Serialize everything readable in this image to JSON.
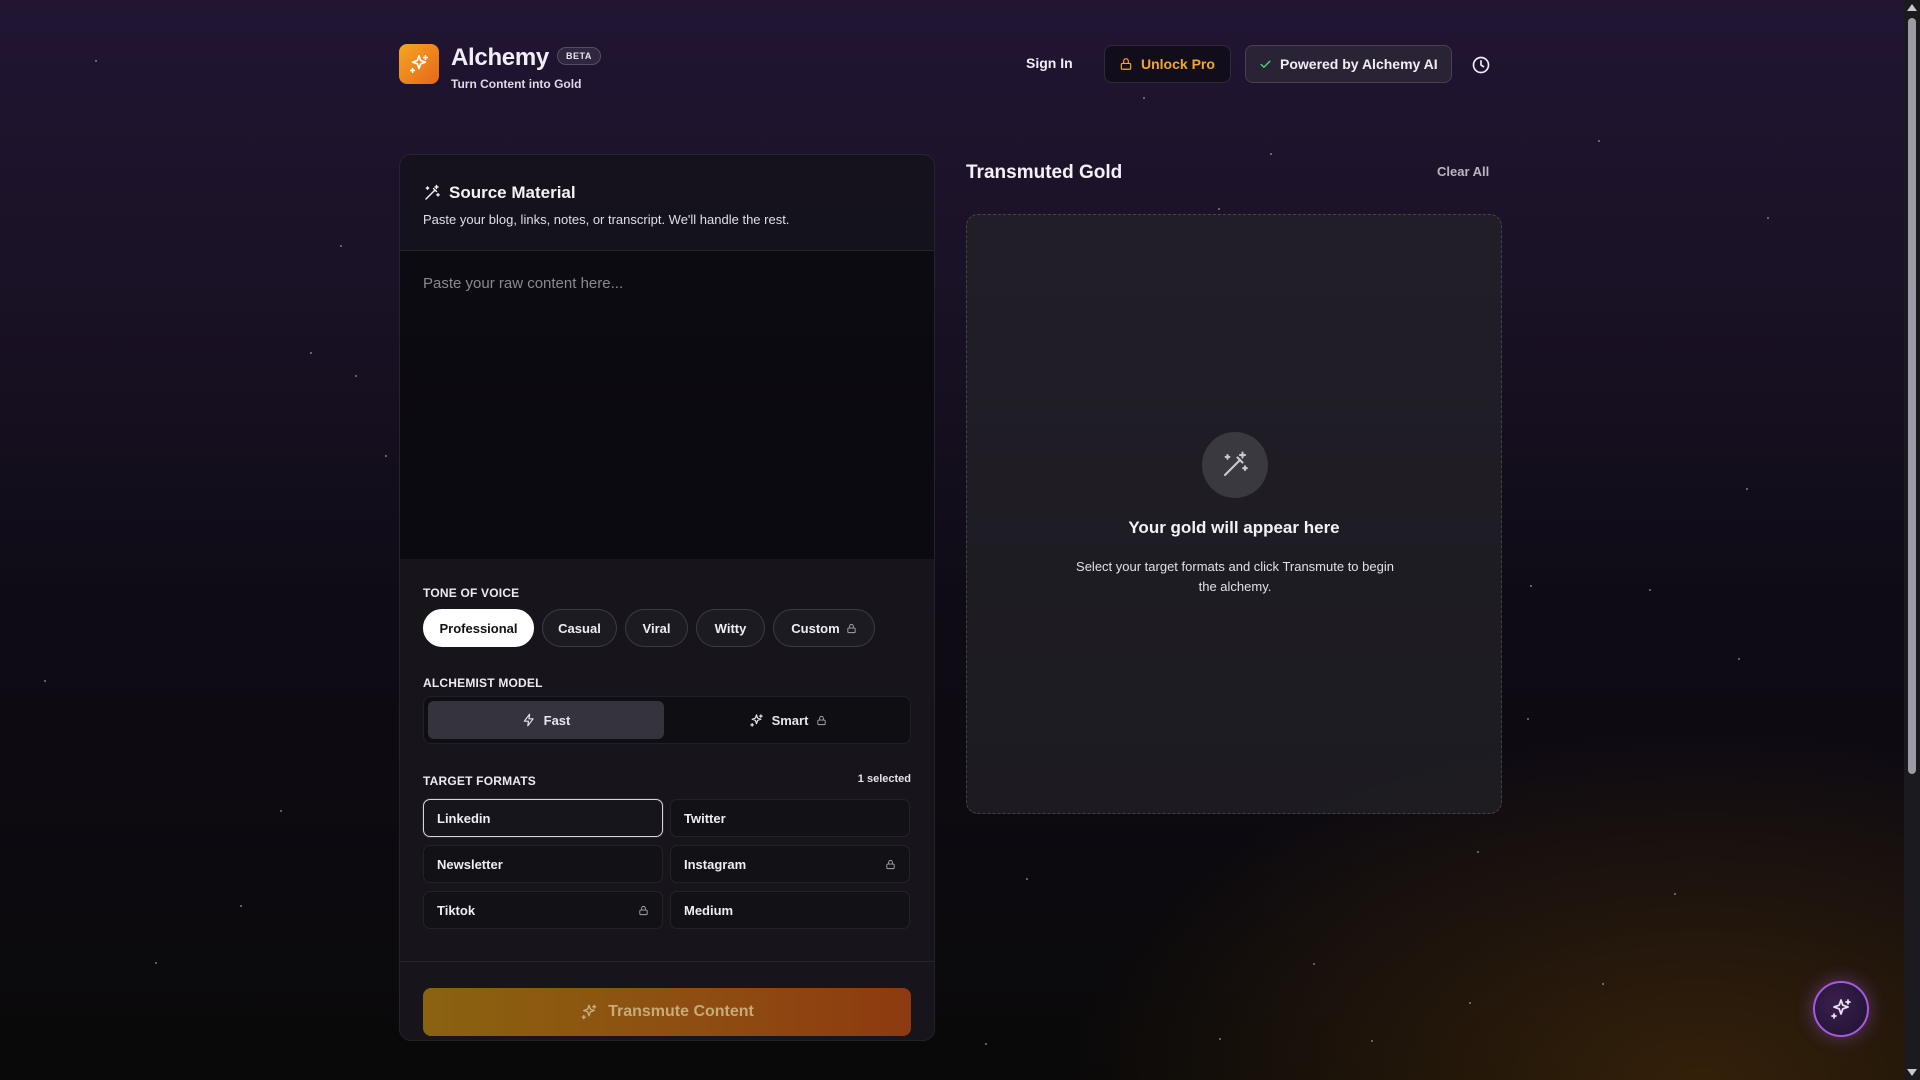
{
  "header": {
    "brand_name": "Alchemy",
    "beta_badge": "BETA",
    "tagline": "Turn Content into Gold",
    "sign_in": "Sign In",
    "unlock_pro": "Unlock Pro",
    "powered_by": "Powered by Alchemy AI"
  },
  "source": {
    "title": "Source Material",
    "subtitle": "Paste your blog, links, notes, or transcript. We'll handle the rest.",
    "input_value": "",
    "input_placeholder": "Paste your raw content here..."
  },
  "tone": {
    "label": "TONE OF VOICE",
    "options": [
      "Professional",
      "Casual",
      "Viral",
      "Witty",
      "Custom"
    ],
    "selected": "Professional",
    "locked": [
      "Custom"
    ]
  },
  "model": {
    "label": "ALCHEMIST MODEL",
    "options": [
      "Fast",
      "Smart"
    ],
    "selected": "Fast",
    "locked": [
      "Smart"
    ]
  },
  "formats": {
    "label": "TARGET FORMATS",
    "selected_count": "1 selected",
    "items": [
      "Linkedin",
      "Twitter",
      "Newsletter",
      "Instagram",
      "Tiktok",
      "Medium"
    ],
    "selected": [
      "Linkedin"
    ],
    "locked": [
      "Instagram",
      "Tiktok"
    ]
  },
  "transmute_button": "Transmute Content",
  "output": {
    "title": "Transmuted Gold",
    "clear_all": "Clear All",
    "empty_title": "Your gold will appear here",
    "empty_subtitle": "Select your target formats and click Transmute to begin the alchemy."
  },
  "icons": {
    "logo": "sparkles-icon",
    "unlock": "lock-icon",
    "powered": "check-icon",
    "history": "clock-icon",
    "source_title": "magic-wand-icon",
    "fast": "lightning-icon",
    "smart": "sparkles-icon",
    "transmute": "sparkles-icon",
    "empty_state": "magic-wand-icon",
    "fab": "sparkles-icon"
  },
  "colors": {
    "accent_orange": "#f3a532",
    "logo_gradient_start": "#f5a623",
    "logo_gradient_end": "#e8661a",
    "fab_border": "#a35be0"
  }
}
